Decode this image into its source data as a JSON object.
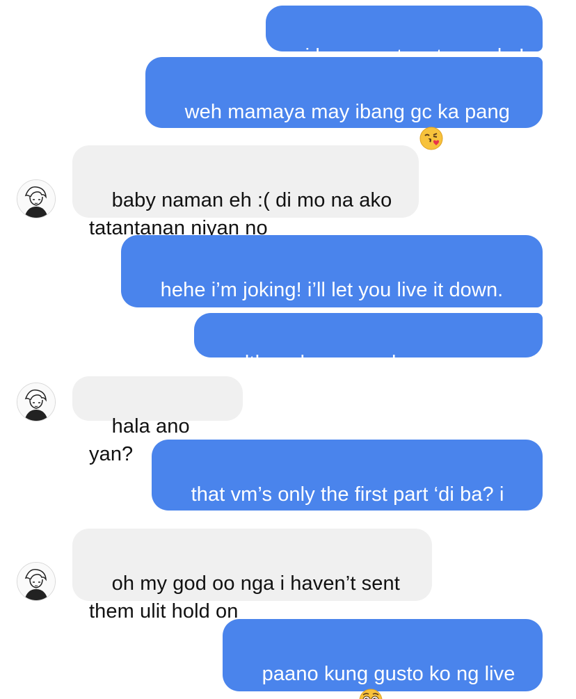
{
  "chat": {
    "messages": [
      {
        "from": "me",
        "text": "i love you too, tsumu ko!"
      },
      {
        "from": "me",
        "text": "weh mamaya may ibang gc ka pang\npinadalhan HAHAHA CHAR",
        "emoji": "face-blowing-a-kiss"
      },
      {
        "from": "them",
        "text": "baby naman eh :( di mo na ako\ntatantanan niyan no"
      },
      {
        "from": "me",
        "text": "hehe i’m joking! i’ll let you live it down.\nsomeday :P"
      },
      {
        "from": "me",
        "text": "although meron akong concern"
      },
      {
        "from": "them",
        "text": "hala ano yan?"
      },
      {
        "from": "me",
        "text": "that vm’s only the first part ‘di ba? i\nwant to hear the rest :("
      },
      {
        "from": "them",
        "text": "oh my god oo nga i haven’t sent\nthem ulit hold on"
      },
      {
        "from": "me",
        "text": "paano kung gusto ko ng live\nperformance",
        "emoji": "pleading-face"
      }
    ]
  },
  "colors": {
    "outgoing_bubble": "#4a84ec",
    "incoming_bubble": "#f0f0f0",
    "outgoing_text": "#ffffff",
    "incoming_text": "#111111"
  }
}
